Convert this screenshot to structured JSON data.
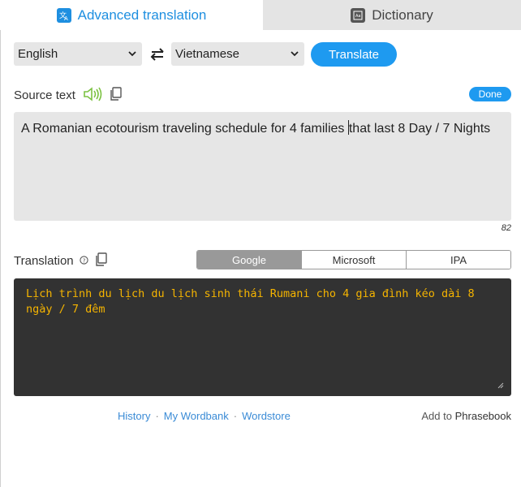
{
  "tabs": {
    "advanced": "Advanced translation",
    "dictionary": "Dictionary"
  },
  "languages": {
    "source": "English",
    "target": "Vietnamese"
  },
  "translate_button": "Translate",
  "source": {
    "label": "Source text",
    "done_label": "Done",
    "text_before_caret": "A Romanian ecotourism traveling schedule for 4 families ",
    "text_after_caret": "that last 8 Day / 7 Nights",
    "char_count": "82"
  },
  "translation": {
    "label": "Translation",
    "engines": [
      "Google",
      "Microsoft",
      "IPA"
    ],
    "active_engine": "Google",
    "text": "Lịch trình du lịch du lịch sinh thái Rumani cho 4 gia đình kéo dài 8 ngày / 7 đêm"
  },
  "footer": {
    "history": "History",
    "wordbank": "My Wordbank",
    "wordstore": "Wordstore",
    "separator": "·",
    "add_to": "Add to",
    "phrasebook": "Phrasebook"
  },
  "colors": {
    "accent": "#1e9af0",
    "translation_bg": "#323232",
    "translation_text": "#f5b400",
    "speaker_green": "#7cc242"
  }
}
